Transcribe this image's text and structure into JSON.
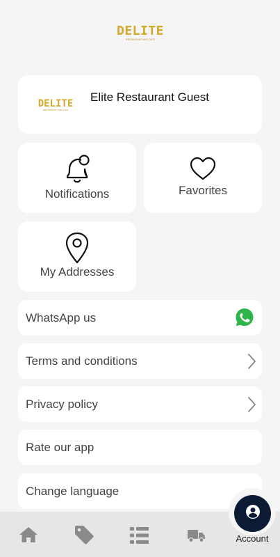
{
  "header": {
    "logo_text": "DELITE",
    "logo_tagline": "RESTAURANT AND CAFE"
  },
  "profile": {
    "name": "Elite Restaurant Guest"
  },
  "tiles": {
    "notifications": {
      "label": "Notifications",
      "icon": "bell-badge-icon"
    },
    "favorites": {
      "label": "Favorites",
      "icon": "heart-icon"
    },
    "addresses": {
      "label": "My Addresses",
      "icon": "location-pin-icon"
    }
  },
  "rows": {
    "whatsapp": {
      "label": "WhatsApp us",
      "icon": "whatsapp-icon"
    },
    "terms": {
      "label": "Terms and conditions",
      "icon": "chevron-right-icon"
    },
    "privacy": {
      "label": "Privacy policy",
      "icon": "chevron-right-icon"
    },
    "rate": {
      "label": "Rate our app"
    },
    "language": {
      "label": "Change language"
    }
  },
  "bottom_nav": {
    "items": [
      {
        "icon": "home-icon"
      },
      {
        "icon": "tag-icon"
      },
      {
        "icon": "menu-list-icon"
      },
      {
        "icon": "delivery-truck-icon"
      }
    ],
    "active": {
      "label": "Account",
      "icon": "account-icon"
    }
  },
  "colors": {
    "logo_gold": "#d4a82a",
    "account_circle": "#0d1a33",
    "whatsapp_green": "#2fb54a",
    "nav_icon": "#8a8a8a"
  }
}
